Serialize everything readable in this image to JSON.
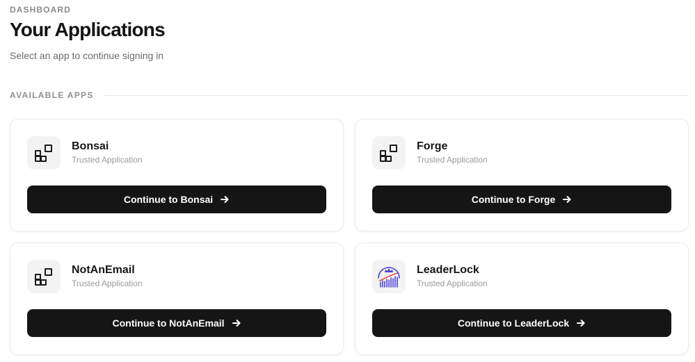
{
  "header": {
    "eyebrow": "DASHBOARD",
    "title": "Your Applications",
    "subtitle": "Select an app to continue signing in"
  },
  "section": {
    "label": "AVAILABLE APPS"
  },
  "apps": [
    {
      "name": "Bonsai",
      "meta": "Trusted Application",
      "button_label": "Continue to Bonsai",
      "icon": "grid-blocks-icon"
    },
    {
      "name": "Forge",
      "meta": "Trusted Application",
      "button_label": "Continue to Forge",
      "icon": "grid-blocks-icon"
    },
    {
      "name": "NotAnEmail",
      "meta": "Trusted Application",
      "button_label": "Continue to NotAnEmail",
      "icon": "grid-blocks-icon"
    },
    {
      "name": "LeaderLock",
      "meta": "Trusted Application",
      "button_label": "Continue to LeaderLock",
      "icon": "leaderlock-logo-icon"
    }
  ],
  "colors": {
    "button_bg": "#151515",
    "button_text": "#ffffff",
    "icon_tile": "#f3f3f3",
    "leaderlock_accent": "#4a3fd6"
  }
}
